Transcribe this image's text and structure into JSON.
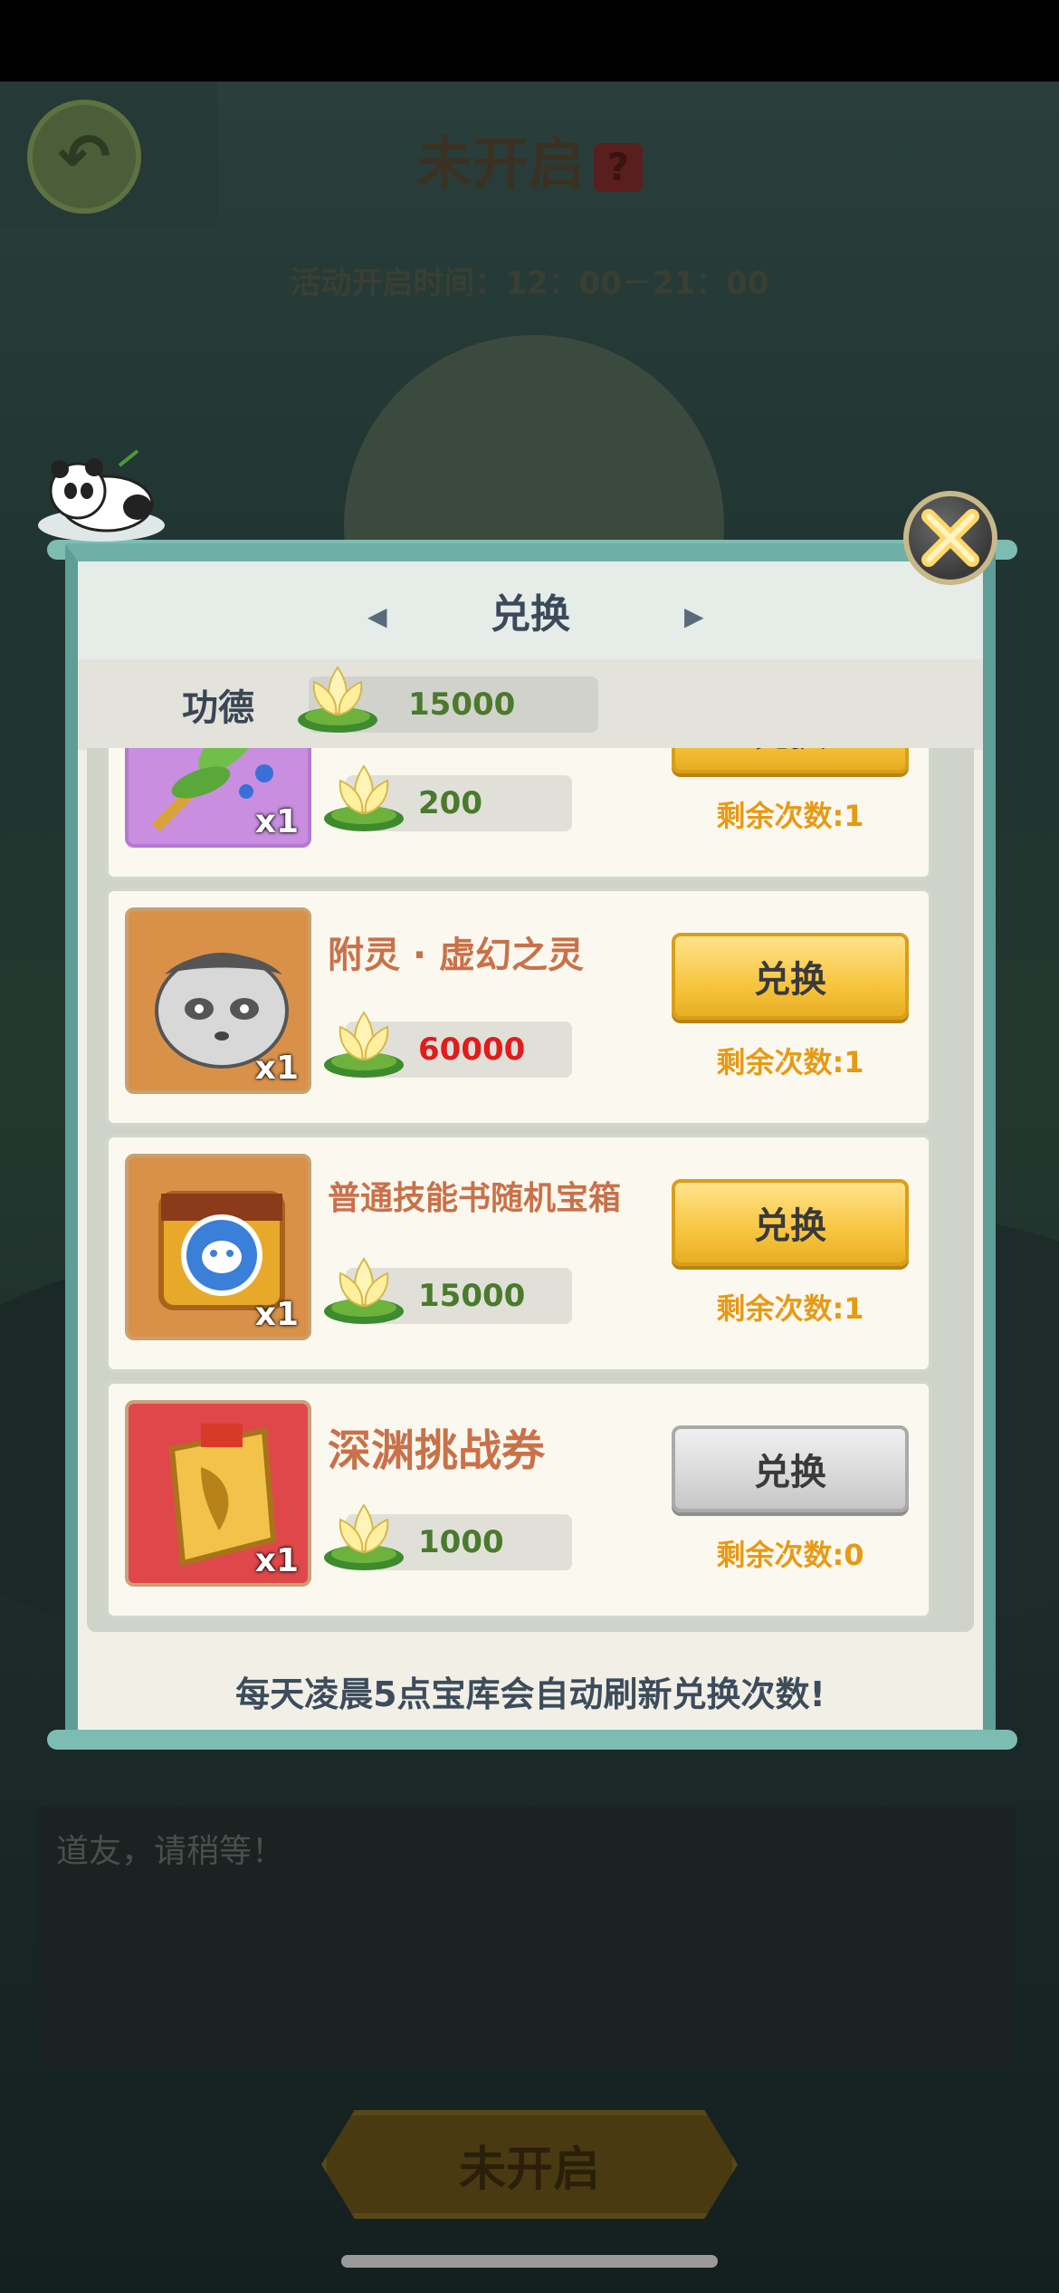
{
  "background": {
    "title": "未开启",
    "help_icon": "?",
    "activity_time": "活动开启时间：12：00－21：00",
    "chat_placeholder": "道友，请稍等！",
    "bottom_button": "未开启"
  },
  "dialog": {
    "title": "兑换",
    "merit_label": "功德",
    "merit_value": "15000",
    "footer_note": "每天凌晨5点宝库会自动刷新兑换次数!",
    "items": [
      {
        "name": "",
        "qty": "x1",
        "price": "200",
        "button": "兑换",
        "remaining": "剩余次数:1",
        "icon": "jade-branch-icon",
        "price_color": "green"
      },
      {
        "name": "附灵 · 虚幻之灵",
        "qty": "x1",
        "price": "60000",
        "button": "兑换",
        "remaining": "剩余次数:1",
        "icon": "panda-spirit-icon",
        "price_color": "red"
      },
      {
        "name": "普通技能书随机宝箱",
        "qty": "x1",
        "price": "15000",
        "button": "兑换",
        "remaining": "剩余次数:1",
        "icon": "skill-book-chest-icon",
        "price_color": "green"
      },
      {
        "name": "深渊挑战券",
        "qty": "x1",
        "price": "1000",
        "button": "兑换",
        "remaining": "剩余次数:0",
        "icon": "challenge-scroll-icon",
        "price_color": "green",
        "disabled": true
      }
    ]
  },
  "colors": {
    "frame": "#5e9e96",
    "gold_button": "#f7c640",
    "remaining_text": "#e69a16",
    "price_green": "#4a7a2c",
    "price_red": "#e01c1c",
    "item_name": "#c9714a"
  }
}
